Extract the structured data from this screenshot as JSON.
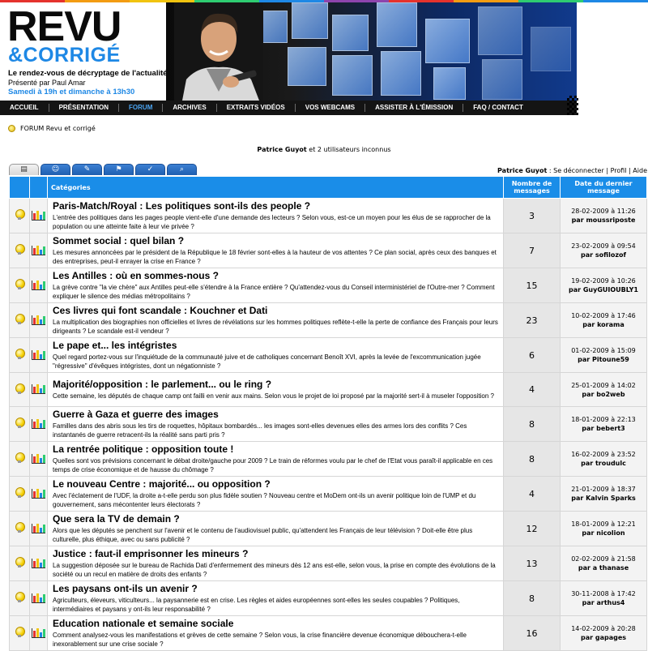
{
  "colors": {
    "accent_blue": "#1a8de8",
    "nav_bg": "#141414",
    "stripe": [
      "#e5322d",
      "#f39c12",
      "#f1c40f",
      "#2ecc71",
      "#1e88e5",
      "#8e44ad",
      "#e5322d",
      "#f39c12",
      "#2ecc71",
      "#1e88e5"
    ]
  },
  "header": {
    "logo_top": "REVU",
    "logo_bottom": "&CORRIGÉ",
    "tagline": "Le rendez-vous de décryptage de l'actualité",
    "presenter": "Présenté par Paul Amar",
    "schedule": "Samedi à 19h et dimanche à 13h30"
  },
  "nav": [
    {
      "label": "ACCUEIL",
      "active": false
    },
    {
      "label": "PRÉSENTATION",
      "active": false
    },
    {
      "label": "FORUM",
      "active": true
    },
    {
      "label": "ARCHIVES",
      "active": false
    },
    {
      "label": "EXTRAITS VIDÉOS",
      "active": false
    },
    {
      "label": "VOS WEBCAMS",
      "active": false
    },
    {
      "label": "ASSISTER À L'ÉMISSION",
      "active": false
    },
    {
      "label": "FAQ / CONTACT",
      "active": false
    }
  ],
  "breadcrumb": {
    "icon": "bulb-icon",
    "label": "FORUM Revu et corrigé"
  },
  "online": {
    "user": "Patrice Guyot",
    "rest": " et 2 utilisateurs inconnus"
  },
  "tabs": [
    {
      "icon": "document-icon",
      "glyph": "▤"
    },
    {
      "icon": "users-icon",
      "glyph": "☺"
    },
    {
      "icon": "user-edit-icon",
      "glyph": "✎"
    },
    {
      "icon": "flag-icon",
      "glyph": "⚑"
    },
    {
      "icon": "tools-icon",
      "glyph": "✓"
    },
    {
      "icon": "search-icon",
      "glyph": "⌕"
    }
  ],
  "userbar": {
    "user": "Patrice Guyot",
    "separator": " : ",
    "logout": "Se déconnecter",
    "pipe1": " | ",
    "profile": "Profil",
    "pipe2": " | ",
    "help": "Aide"
  },
  "table": {
    "col_categories": "Catégories",
    "col_count": "Nombre de messages",
    "col_last": "Date du dernier message",
    "by_prefix": "par ",
    "rows": [
      {
        "title": "Paris-Match/Royal : Les politiques sont-ils des people ?",
        "desc": "L'entrée des politiques dans les pages people vient-elle d'une demande des lecteurs ? Selon vous, est-ce un moyen pour les élus de se rapprocher de la population ou une atteinte faite à leur vie privée ?",
        "count": "3",
        "date": "28-02-2009 à 11:26",
        "author": "moussriposte"
      },
      {
        "title": "Sommet social : quel bilan ?",
        "desc": "Les mesures annoncées par le président de la République le 18 février sont-elles à la hauteur de vos attentes ? Ce plan social, après ceux des banques et des entreprises, peut-il enrayer la crise en France ?",
        "count": "7",
        "date": "23-02-2009 à 09:54",
        "author": "sofilozof"
      },
      {
        "title": "Les Antilles : où en sommes-nous ?",
        "desc": "La grève contre \"la vie chère\" aux Antilles peut-elle s'étendre à la France entière ? Qu'attendez-vous du Conseil interministériel de l'Outre-mer ? Comment expliquer le silence des médias métropolitains ?",
        "count": "15",
        "date": "19-02-2009 à 10:26",
        "author": "GuyGUIOUBLY1"
      },
      {
        "title": "Ces livres qui font scandale : Kouchner et Dati",
        "desc": "La multiplication des biographies non officielles et livres de révélations sur les hommes politiques reflète-t-elle la perte de confiance des Français pour leurs dirigeants ? Le scandale est-il vendeur ?",
        "count": "23",
        "date": "10-02-2009 à 17:46",
        "author": "korama"
      },
      {
        "title": "Le pape et... les intégristes",
        "desc": "Quel regard portez-vous sur l'inquiétude de la communauté juive et de catholiques concernant Benoît XVI, après la levée de l'excommunication jugée \"régressive\" d'évêques intégristes, dont un négationniste ?",
        "count": "6",
        "date": "01-02-2009 à 15:09",
        "author": "Pitoune59"
      },
      {
        "title": "Majorité/opposition : le parlement... ou le ring ?",
        "desc": "Cette semaine, les députés de chaque camp ont failli en venir aux mains. Selon vous le projet de loi proposé par la majorité sert-il à museler l'opposition ?",
        "count": "4",
        "date": "25-01-2009 à 14:02",
        "author": "bo2web"
      },
      {
        "title": "Guerre à Gaza et guerre des images",
        "desc": "Familles dans des abris sous les tirs de roquettes, hôpitaux bombardés... les images sont-elles devenues elles des armes lors des conflits ? Ces instantanés de guerre retracent-ils la réalité sans parti pris ?",
        "count": "8",
        "date": "18-01-2009 à 22:13",
        "author": "bebert3"
      },
      {
        "title": "La rentrée politique : opposition toute !",
        "desc": "Quelles sont vos prévisions concernant le débat droite/gauche pour 2009 ? Le train de réformes voulu par le chef de l'Etat vous paraît-il applicable en ces temps de crise économique et de hausse du chômage ?",
        "count": "8",
        "date": "16-02-2009 à 23:52",
        "author": "troudulc"
      },
      {
        "title": "Le nouveau Centre : majorité... ou opposition ?",
        "desc": "Avec l'éclatement de l'UDF, la droite a-t-elle perdu son plus fidèle soutien ? Nouveau centre et MoDem ont-ils un avenir politique loin de l'UMP et du gouvernement, sans mécontenter leurs électorats ?",
        "count": "4",
        "date": "21-01-2009 à 18:37",
        "author": "Kalvin Sparks"
      },
      {
        "title": "Que sera la TV de demain ?",
        "desc": "Alors que les députés se penchent sur l'avenir et le contenu de l'audiovisuel public, qu'attendent les Français de leur télévision ? Doit-elle être plus culturelle, plus éthique, avec ou sans publicité ?",
        "count": "12",
        "date": "18-01-2009 à 12:21",
        "author": "nicolion"
      },
      {
        "title": "Justice : faut-il emprisonner les mineurs ?",
        "desc": "La suggestion déposée sur le bureau de Rachida Dati d'enfermement des mineurs dès 12 ans est-elle, selon vous, la prise en compte des évolutions de la société ou un recul en matière de droits des enfants ?",
        "count": "13",
        "date": "02-02-2009 à 21:58",
        "author": "a thanase"
      },
      {
        "title": "Les paysans ont-ils un avenir ?",
        "desc": "Agriculteurs, éleveurs, viticulteurs... la paysannerie est en crise. Les règles et aides européennes sont-elles les seules coupables ? Politiques, intermédiaires et paysans y ont-ils leur responsabilité ?",
        "count": "8",
        "date": "30-11-2008 à 17:42",
        "author": "arthus4"
      },
      {
        "title": "Education nationale et semaine sociale",
        "desc": "Comment analysez-vous les manifestations et grèves de cette semaine ? Selon vous, la crise financière devenue économique débouchera-t-elle inexorablement sur une crise sociale ?",
        "count": "16",
        "date": "14-02-2009 à 20:28",
        "author": "gapages"
      }
    ]
  }
}
